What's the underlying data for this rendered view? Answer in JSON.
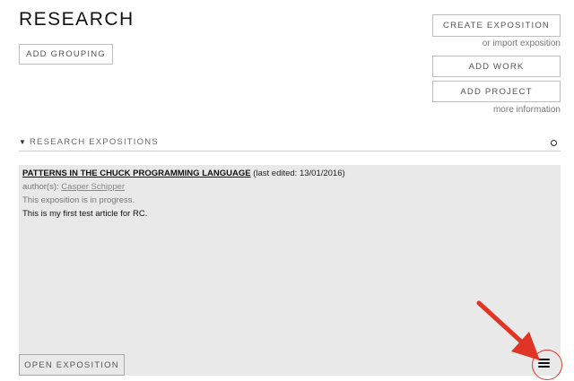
{
  "page": {
    "title": "RESEARCH"
  },
  "actions": {
    "add_grouping": "ADD GROUPING",
    "create_exposition": "CREATE EXPOSITION",
    "import_exposition": "or import exposition",
    "add_work": "ADD WORK",
    "add_project": "ADD PROJECT",
    "more_information": "more information"
  },
  "section": {
    "title": "RESEARCH EXPOSITIONS",
    "toggle_icon": "caret-down-icon",
    "settings_icon": "circle-icon"
  },
  "exposition": {
    "title": "PATTERNS IN THE CHUCK PROGRAMMING LANGUAGE",
    "last_edited": "(last edited: 13/01/2016)",
    "authors_label": "author(s):",
    "author": "Casper Schipper",
    "status": "This exposition is in progress.",
    "description": "This is my first test article for RC.",
    "open_button": "OPEN EXPOSITION",
    "menu_icon": "hamburger-menu-icon"
  },
  "annotation": {
    "color": "#e03524",
    "arrow_icon": "red-arrow",
    "highlight": "red-circle"
  }
}
